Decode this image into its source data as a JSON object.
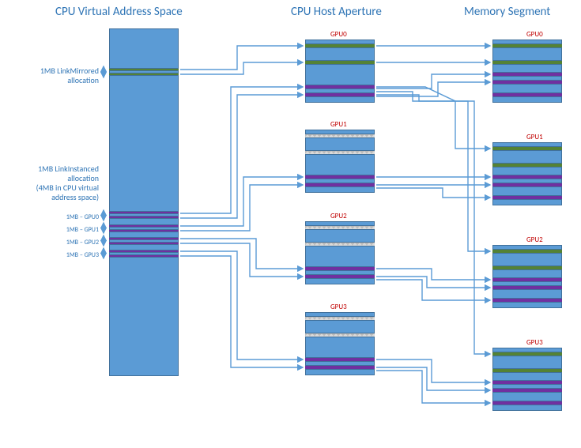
{
  "headers": {
    "cva": "CPU Virtual Address Space",
    "cha": "CPU Host Aperture",
    "ms": "Memory Segment"
  },
  "labels": {
    "mirrored_line1": "1MB LinkMirrored",
    "mirrored_line2": "allocation",
    "instanced_line1": "1MB LinkInstanced",
    "instanced_line2": "allocation",
    "instanced_line3": "(4MB in CPU virtual",
    "instanced_line4": "address space)",
    "mb_gpu0": "1MB – GPU0",
    "mb_gpu1": "1MB – GPU1",
    "mb_gpu2": "1MB – GPU2",
    "mb_gpu3": "1MB – GPU3"
  },
  "gpu": {
    "g0": "GPU0",
    "g1": "GPU1",
    "g2": "GPU2",
    "g3": "GPU3"
  },
  "chart_data": {
    "type": "diagram",
    "title": "CPU Virtual Address Space mapping to CPU Host Aperture and Memory Segments",
    "columns": [
      "CPU Virtual Address Space",
      "CPU Host Aperture",
      "Memory Segment"
    ],
    "gpus": [
      "GPU0",
      "GPU1",
      "GPU2",
      "GPU3"
    ],
    "allocations": [
      {
        "name": "LinkMirrored",
        "size_mb": 1,
        "cpu_virtual_mb": 1,
        "host_aperture_present_in": [
          "GPU0",
          "GPU1",
          "GPU2",
          "GPU3"
        ],
        "host_aperture_visible_in": [
          "GPU0"
        ],
        "memory_segment_present_in": [
          "GPU0",
          "GPU1",
          "GPU2",
          "GPU3"
        ],
        "color": "green"
      },
      {
        "name": "LinkInstanced",
        "size_mb": 1,
        "cpu_virtual_mb": 4,
        "host_aperture_present_in": [
          "GPU0",
          "GPU1",
          "GPU2",
          "GPU3"
        ],
        "memory_segment_present_in": [
          "GPU0",
          "GPU1",
          "GPU2",
          "GPU3"
        ],
        "color": "purple"
      }
    ],
    "cpu_virtual_address_space": {
      "mirrored_stripes": 2,
      "instanced_stripes": 8,
      "instanced_slot_labels": [
        "1MB – GPU0",
        "1MB – GPU1",
        "1MB – GPU2",
        "1MB – GPU3"
      ]
    },
    "mappings": [
      {
        "from": "CVA.mirrored",
        "to": "CHA.GPU0.mirrored"
      },
      {
        "from": "CHA.GPU0.mirrored",
        "to": "MS.GPU0.mirrored"
      },
      {
        "from": "CHA.GPU0.mirrored",
        "to": "MS.GPU1.mirrored"
      },
      {
        "from": "CHA.GPU0.mirrored",
        "to": "MS.GPU2.mirrored"
      },
      {
        "from": "CHA.GPU0.mirrored",
        "to": "MS.GPU3.mirrored"
      },
      {
        "from": "CVA.instanced.GPU0",
        "to": "CHA.GPU0.instanced"
      },
      {
        "from": "CVA.instanced.GPU1",
        "to": "CHA.GPU1.instanced"
      },
      {
        "from": "CVA.instanced.GPU2",
        "to": "CHA.GPU2.instanced"
      },
      {
        "from": "CVA.instanced.GPU3",
        "to": "CHA.GPU3.instanced"
      },
      {
        "from": "CHA.GPU0.instanced",
        "to": "MS.GPU0.instanced"
      },
      {
        "from": "CHA.GPU1.instanced",
        "to": "MS.GPU1.instanced"
      },
      {
        "from": "CHA.GPU2.instanced",
        "to": "MS.GPU2.instanced"
      },
      {
        "from": "CHA.GPU3.instanced",
        "to": "MS.GPU3.instanced"
      }
    ]
  }
}
